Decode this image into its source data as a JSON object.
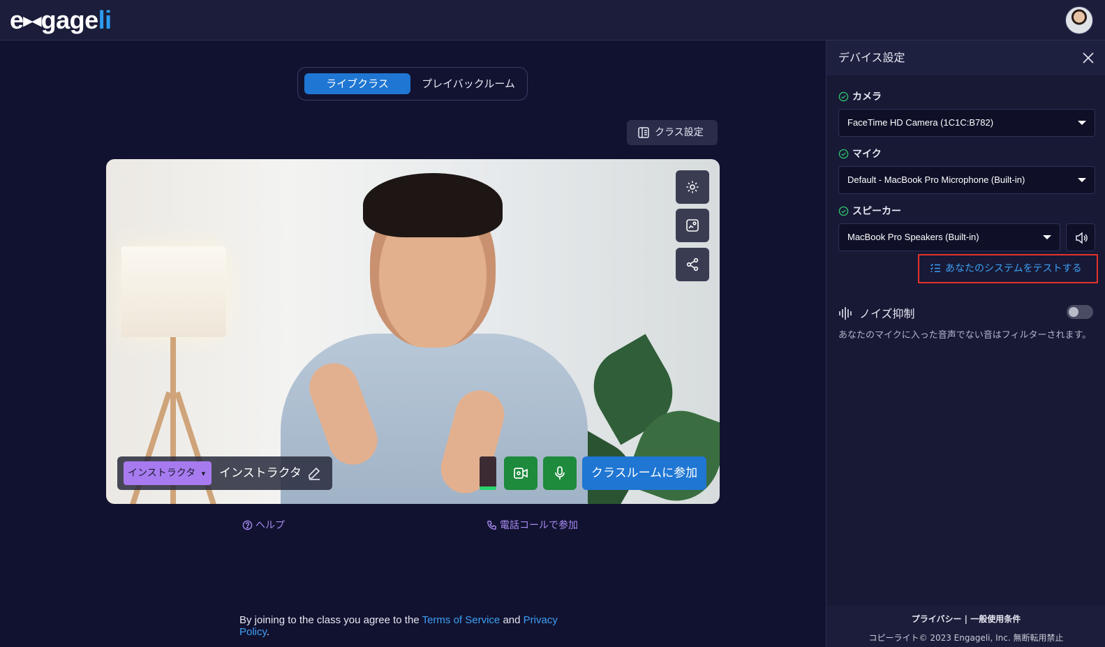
{
  "header": {
    "logo": {
      "part1": "e",
      "mark": "▸◂",
      "part2": "gage",
      "part3": "li"
    },
    "avatar_alt": ""
  },
  "mode_toggle": {
    "options": [
      "ライブクラス",
      "プレイバックルーム"
    ],
    "active": "ライブクラス"
  },
  "class_settings": {
    "label": "クラス設定"
  },
  "preview": {
    "role_label": "インストラクタ",
    "role_caret": "▾",
    "display_name": "インストラクタ",
    "mic_level": 0.1,
    "join_label": "クラスルームに参加"
  },
  "links": {
    "help": "ヘルプ",
    "phone_join": "電話コールで参加"
  },
  "agreement": {
    "prefix": "By joining to the class you agree to the",
    "terms": "Terms of Service",
    "and": "and",
    "privacy": "Privacy Policy",
    "suffix": "."
  },
  "device_panel": {
    "title": "デバイス設定",
    "camera": {
      "label": "カメラ",
      "value": "FaceTime HD Camera (1C1C:B782)"
    },
    "mic": {
      "label": "マイク",
      "value": "Default - MacBook Pro Microphone (Built-in)"
    },
    "speaker": {
      "label": "スピーカー",
      "value": "MacBook Pro Speakers (Built-in)"
    },
    "test_system": "あなたのシステムをテストする",
    "noise": {
      "title": "ノイズ抑制",
      "enabled": false,
      "description": "あなたのマイクに入った音声でない音はフィルターされます。"
    },
    "footer": {
      "privacy": "プライバシー",
      "separator": "|",
      "terms": "一般使用条件",
      "copyright": "コピーライト© 2023 Engageli, Inc. 無断転用禁止"
    }
  },
  "colors": {
    "background": "#111230",
    "primary": "#1f76d3",
    "success": "#1d8a3c",
    "role_chip": "#a77bef",
    "link": "#3ea0f5",
    "highlight_border": "#e5322d"
  }
}
